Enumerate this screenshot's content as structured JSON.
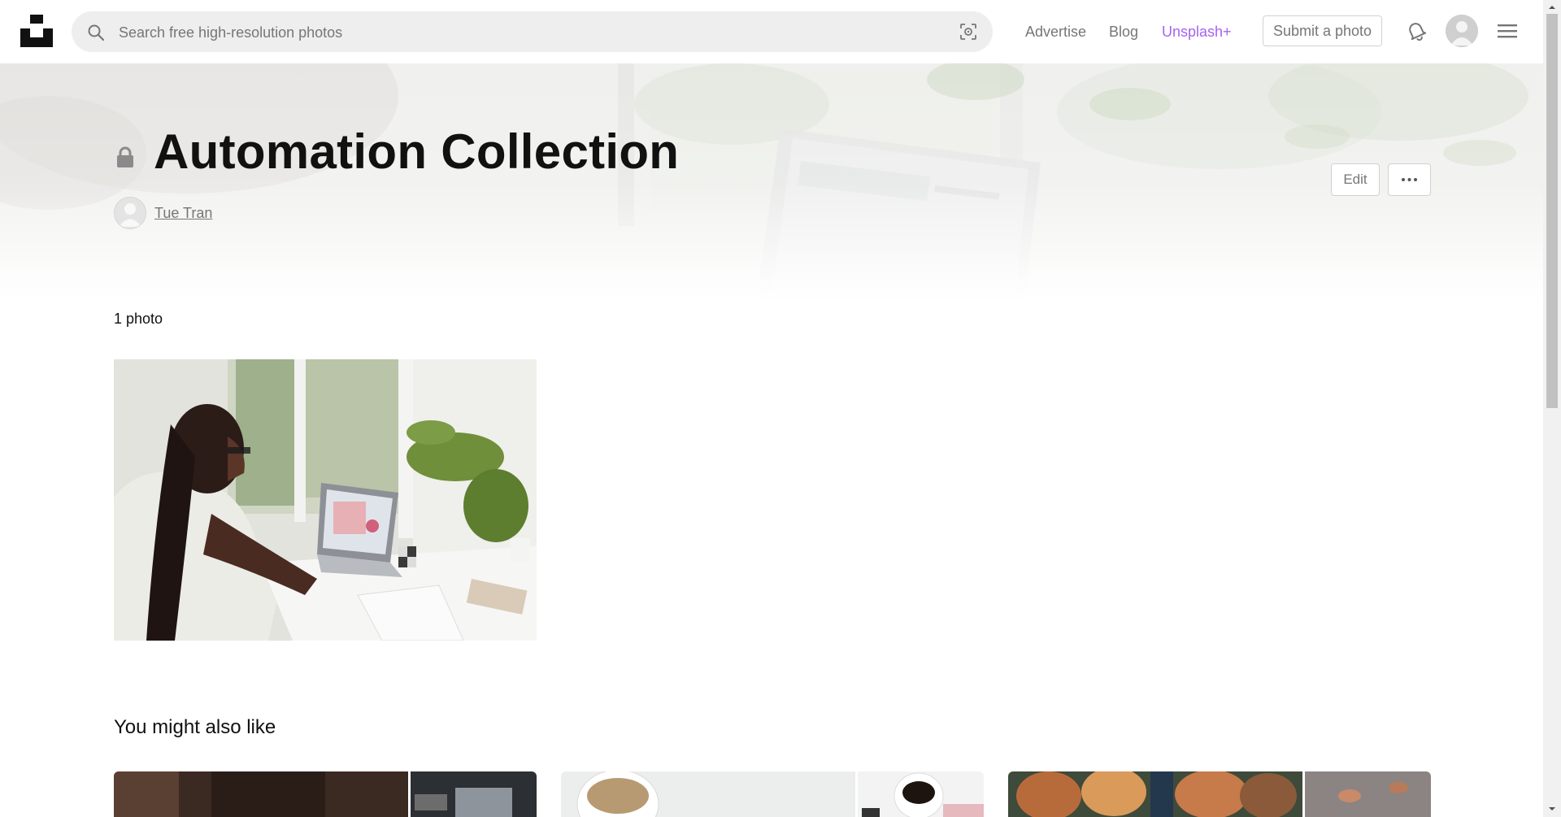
{
  "header": {
    "search_placeholder": "Search free high-resolution photos",
    "nav": {
      "advertise": "Advertise",
      "blog": "Blog",
      "unsplash_plus": "Unsplash+"
    },
    "submit_label": "Submit a photo"
  },
  "collection": {
    "title": "Automation Collection",
    "author": "Tue Tran",
    "private": true,
    "edit_label": "Edit",
    "photo_count": "1 photo"
  },
  "related": {
    "title": "You might also like"
  },
  "colors": {
    "accent_plus": "#a463f2",
    "text_primary": "#111111",
    "text_muted": "#767676",
    "border": "#d1d1d1",
    "search_bg": "#eeeeee"
  },
  "icons": [
    "unsplash-logo",
    "search-icon",
    "visual-search-icon",
    "bell-icon",
    "avatar",
    "hamburger-menu-icon",
    "lock-icon",
    "more-icon"
  ]
}
